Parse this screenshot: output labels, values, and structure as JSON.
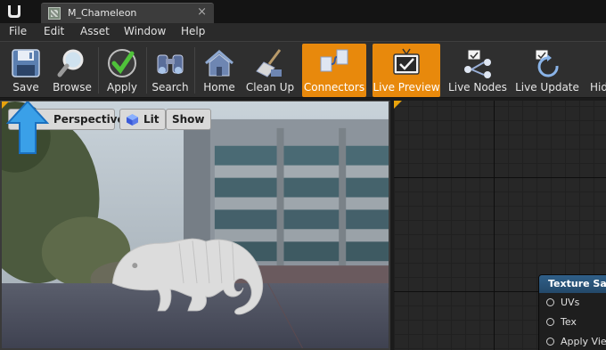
{
  "window": {
    "tab_title": "M_Chameleon",
    "tab_close": "×"
  },
  "menu": [
    "File",
    "Edit",
    "Asset",
    "Window",
    "Help"
  ],
  "toolbar": {
    "save": "Save",
    "browse": "Browse",
    "apply": "Apply",
    "search": "Search",
    "home": "Home",
    "clean_up": "Clean Up",
    "connectors": "Connectors",
    "live_preview": "Live Preview",
    "live_nodes": "Live Nodes",
    "live_update": "Live Update",
    "hide": "Hid"
  },
  "viewport": {
    "perspective": "Perspective",
    "lit": "Lit",
    "show": "Show"
  },
  "graph": {
    "node_title": "Texture Samp",
    "pins": [
      "UVs",
      "Tex",
      "Apply View"
    ]
  },
  "colors": {
    "accent_orange": "#e8890c",
    "node_header_blue": "#2f5f88",
    "arrow_blue": "#3aa0e8"
  }
}
